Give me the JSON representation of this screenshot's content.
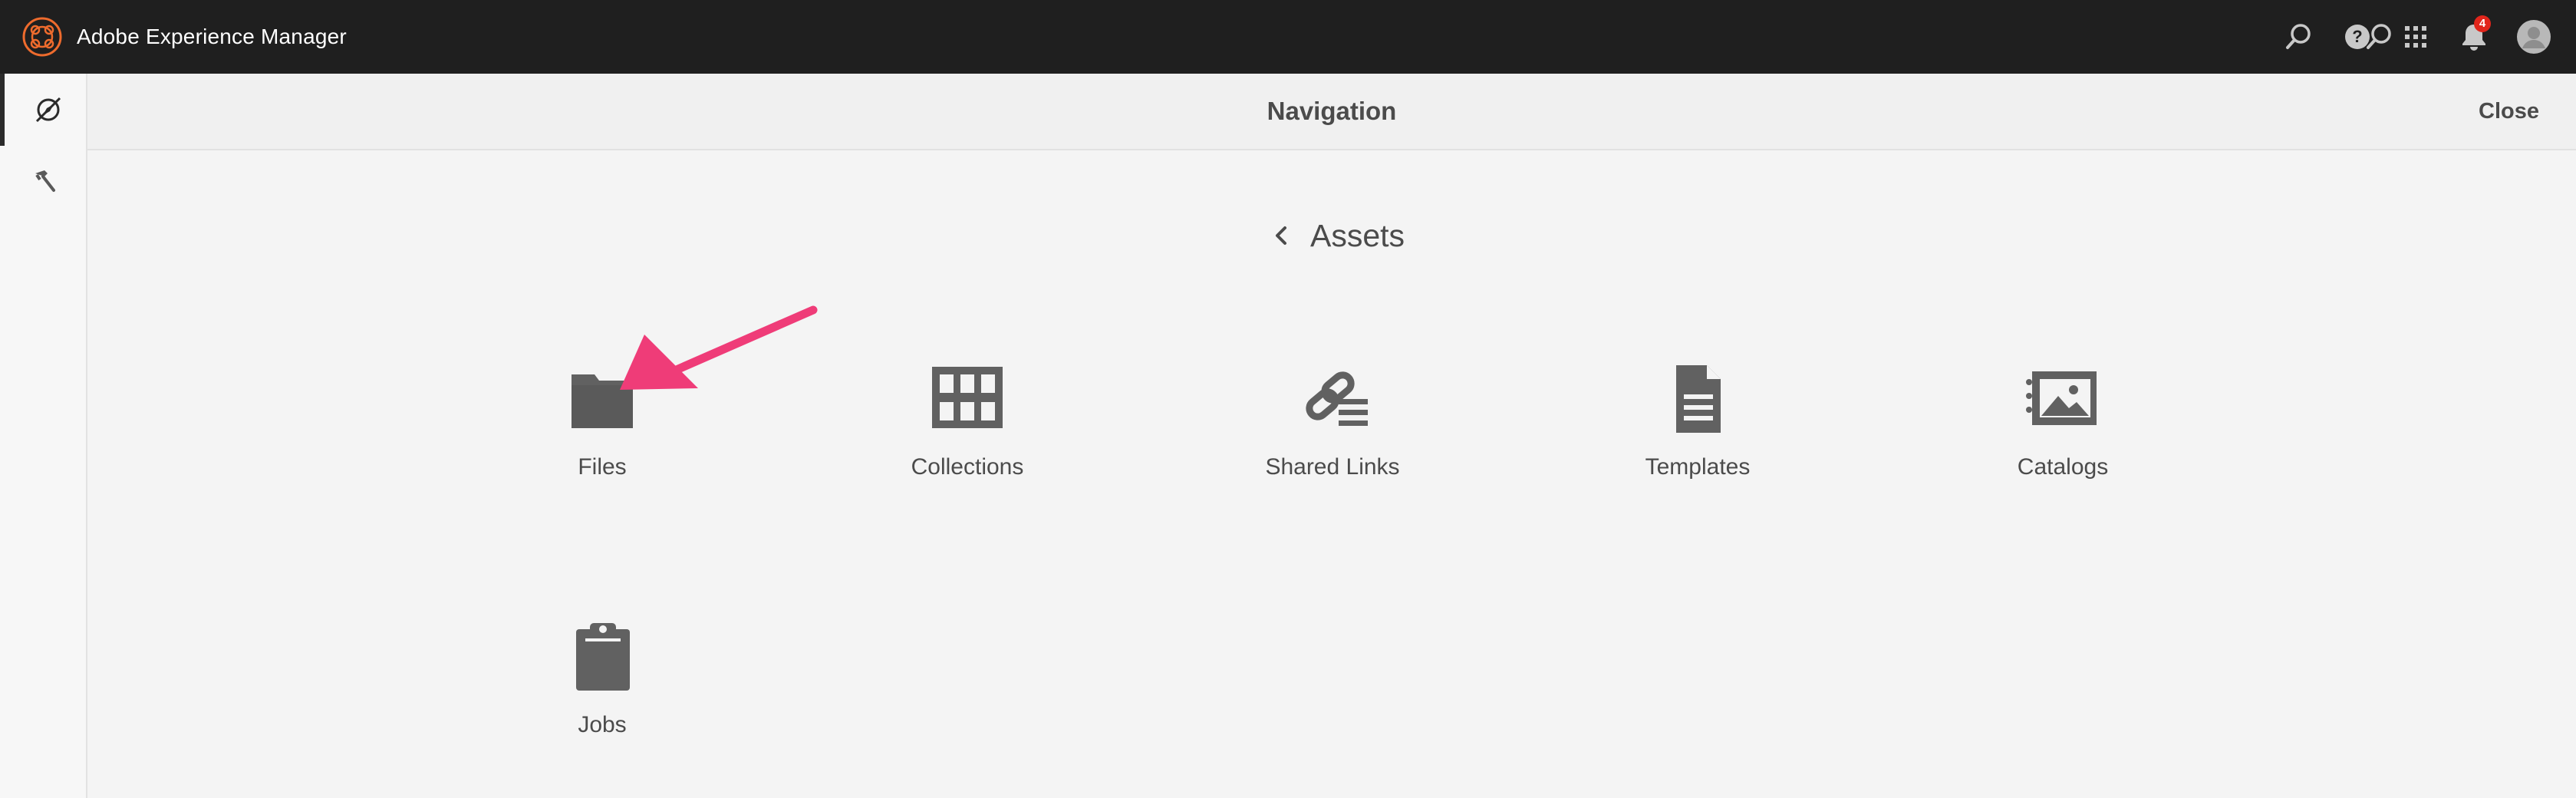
{
  "app": {
    "title": "Adobe Experience Manager"
  },
  "top_actions": {
    "search_icon": "search-icon",
    "help_icon": "help-icon",
    "solutions_icon": "apps-grid-icon",
    "notifications_icon": "bell-icon",
    "notifications_count": "4",
    "avatar_icon": "user-avatar-icon"
  },
  "rail": {
    "items": [
      {
        "icon": "navigation-compass-icon",
        "active": true
      },
      {
        "icon": "tools-hammer-icon",
        "active": false
      }
    ]
  },
  "navigation": {
    "title": "Navigation",
    "close_label": "Close",
    "back_label": "Assets"
  },
  "tiles": [
    {
      "label": "Files",
      "icon": "folder-icon"
    },
    {
      "label": "Collections",
      "icon": "collections-grid-icon"
    },
    {
      "label": "Shared Links",
      "icon": "shared-link-icon"
    },
    {
      "label": "Templates",
      "icon": "template-document-icon"
    },
    {
      "label": "Catalogs",
      "icon": "catalog-image-icon"
    },
    {
      "label": "Jobs",
      "icon": "jobs-clipboard-icon"
    }
  ],
  "colors": {
    "topbar": "#1f1f1f",
    "brand_orange": "#ee6b2d",
    "icon_gray": "#616161",
    "annotation_pink": "#ef3c78",
    "badge_red": "#e1251b"
  }
}
